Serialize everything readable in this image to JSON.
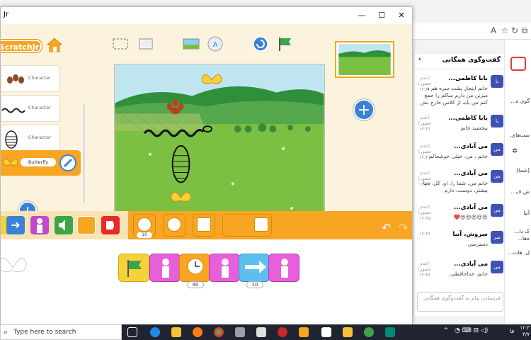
{
  "window": {
    "title": "Jr"
  },
  "app": {
    "logo": "ScratchJr",
    "characters": [
      {
        "label": "Character"
      },
      {
        "label": "Character"
      },
      {
        "label": "Character"
      }
    ],
    "selected_character": "Butterfly",
    "palette_blocks": [
      {
        "name": "wait-block",
        "num": "10"
      },
      {
        "name": "stop-block",
        "num": ""
      },
      {
        "name": "speed-block",
        "num": ""
      },
      {
        "name": "go-to-page-block",
        "num": ""
      },
      {
        "name": "repeat-forever-block",
        "num": ""
      }
    ],
    "script_numbers": {
      "wait": "90",
      "move": "10"
    }
  },
  "chat": {
    "header": "گفت‌وگوی همگانی",
    "messages": [
      {
        "name": "بابا کاظمی...",
        "meta": "(عدم حضور) ۱۲:۳۰",
        "text": "خانم اینجاز پشت سره هم د میزنن من دارم ساکم را جمع کنم من باید از کلاس خارج بش",
        "avatar": "با"
      },
      {
        "name": "بابا کاظمی...",
        "meta": "(عدم حضور) ۱۲:۳۱",
        "text": "ببخشید خانم",
        "avatar": "با"
      },
      {
        "name": "می آبادی...",
        "meta": "(عدم حضور) ۱۲:۳۱",
        "text": "خانم ، من، خیلی خوشحالم",
        "avatar": "می"
      },
      {
        "name": "می آبادی...",
        "meta": "(عدم حضور) ۱۲:۳۲",
        "text": "خانم من، شما را، او، کل، دنیا بیشتر، دوست، دارم",
        "avatar": "می"
      },
      {
        "name": "می آبادی...",
        "meta": "(عدم حضور) ۱۲:۳۵",
        "text": "😍😍😍😍😍❤️",
        "avatar": "می"
      },
      {
        "name": "سروش، آنیا",
        "meta": "۱۲:۳۶",
        "text": "دسترسی",
        "avatar": "سر"
      },
      {
        "name": "می آبادی...",
        "meta": "(عدم حضور) ۱۲:۳۸",
        "text": "خانم، خداحافظی.",
        "avatar": "می"
      }
    ],
    "input_placeholder": "فرستادن پیام به گفت‌وگوی همگانی"
  },
  "sidenav": [
    "گوی ه...",
    "ست‌های.",
    "(شما)",
    "ش ف...",
    "آنیا",
    "ک دا...",
    "ه‌ها...",
    "ل، هات..."
  ],
  "taskbar": {
    "search_placeholder": "Type here to search",
    "lang": "فا",
    "time": "۱۲:۳",
    "date": "۴/۷"
  },
  "colors": {
    "accent": "#f6a623",
    "stage_sky": "#bfe6f0",
    "grass": "#7cc043"
  }
}
